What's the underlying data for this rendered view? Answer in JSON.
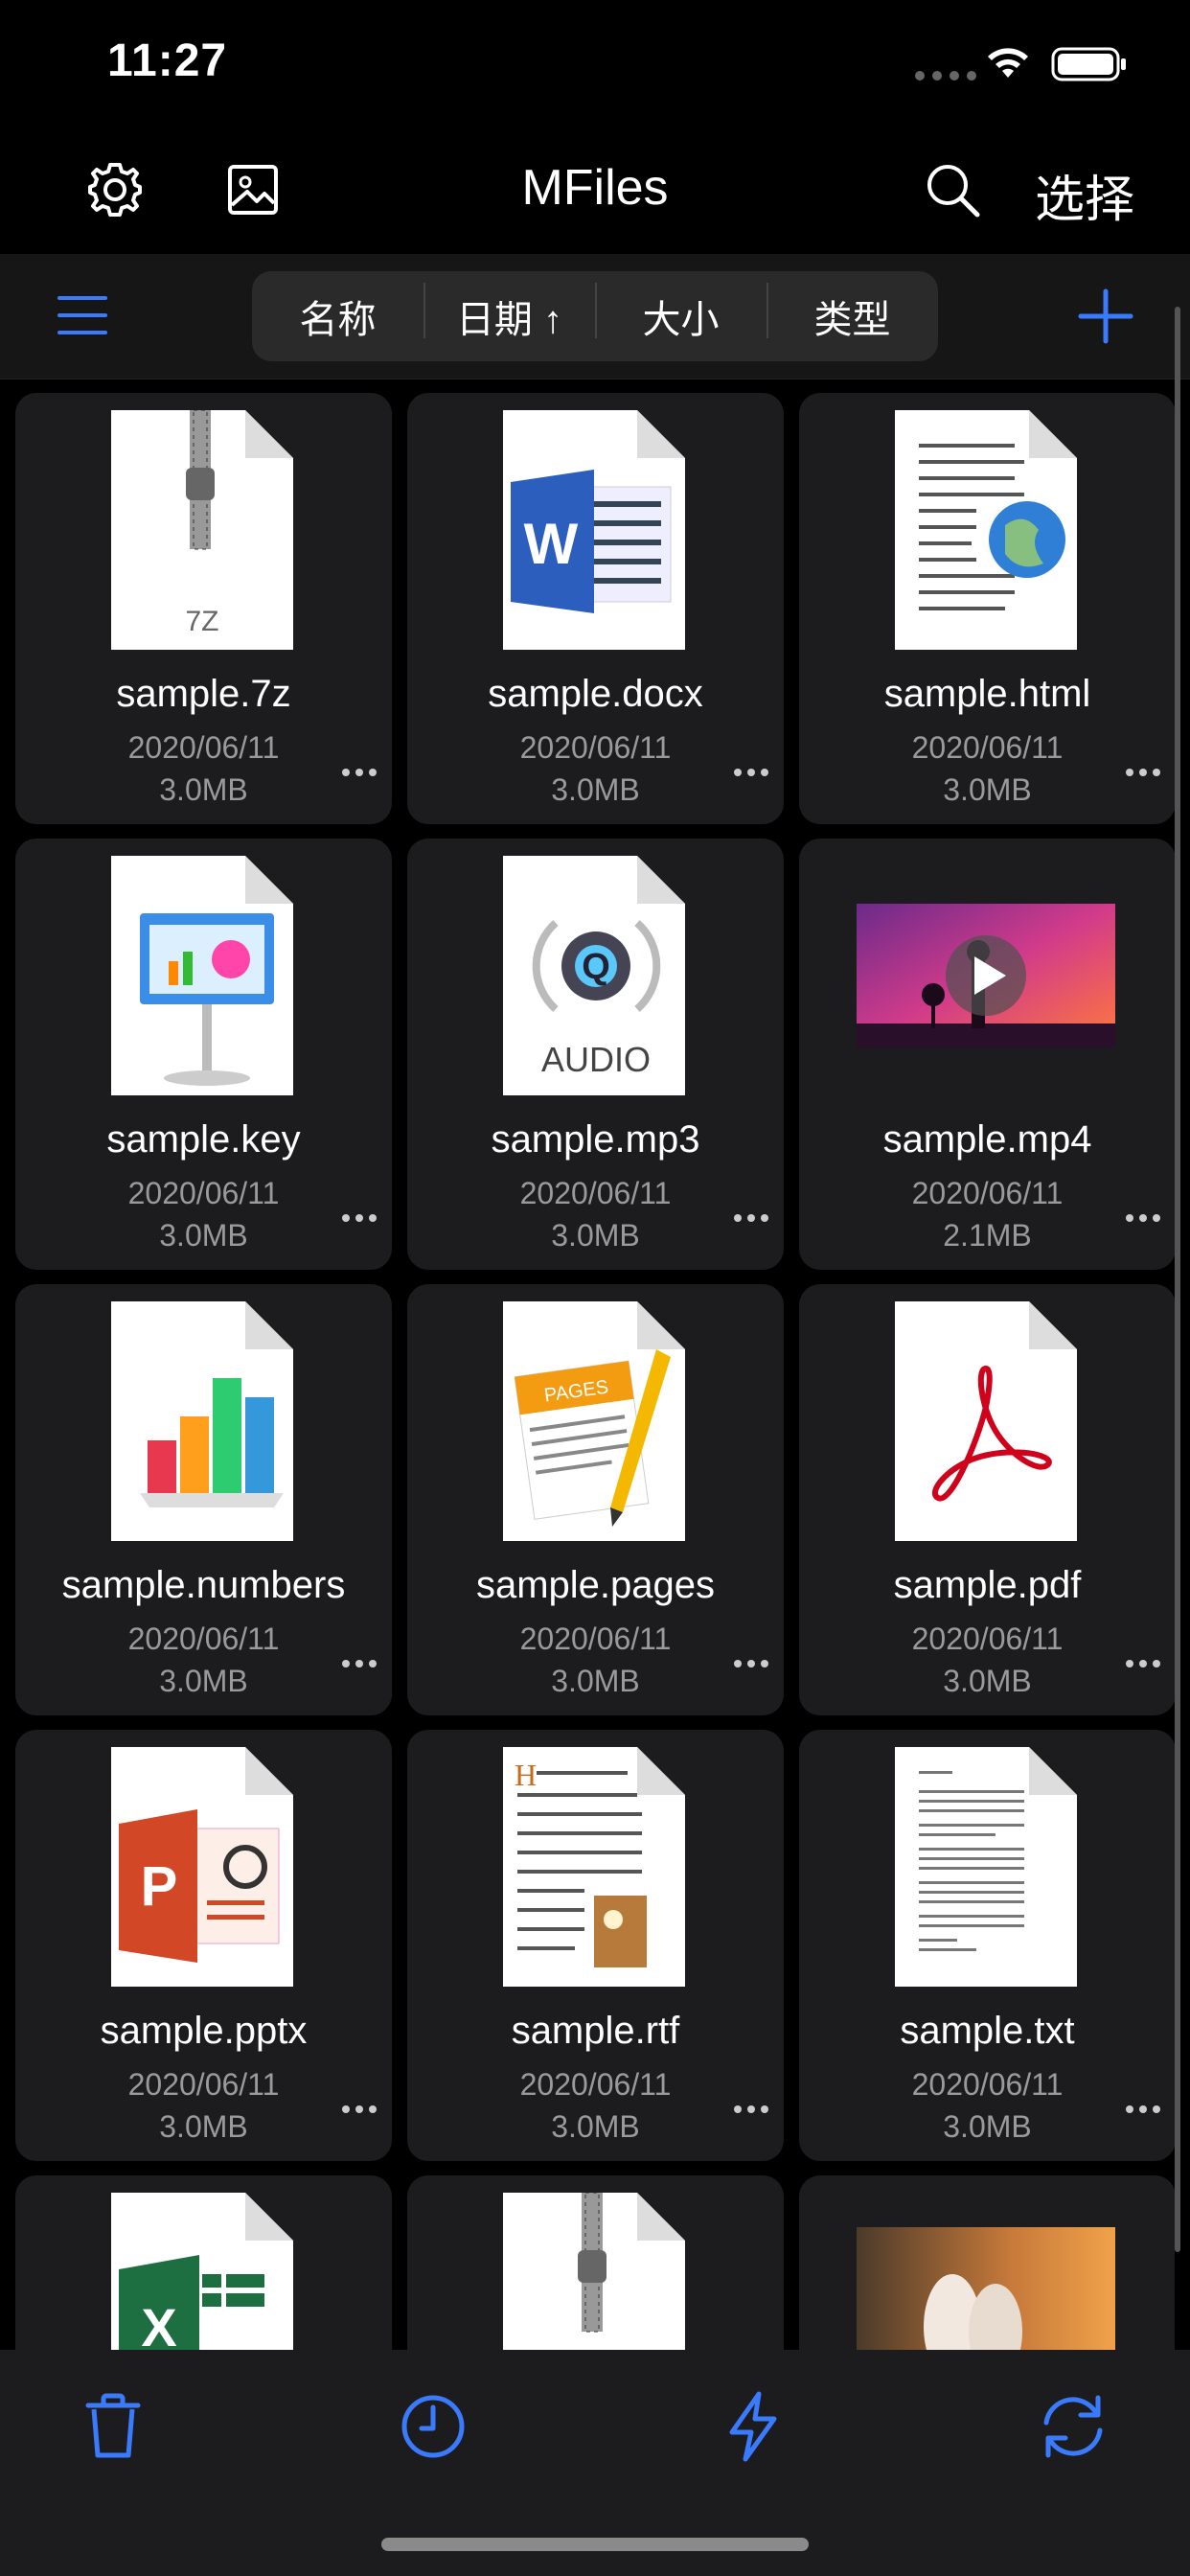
{
  "status_bar": {
    "time": "11:27"
  },
  "nav": {
    "title": "MFiles",
    "select_label": "选择"
  },
  "toolbar": {
    "sort_options": [
      {
        "label": "名称"
      },
      {
        "label": "日期 ↑"
      },
      {
        "label": "大小"
      },
      {
        "label": "类型"
      }
    ]
  },
  "files": [
    {
      "name": "sample.7z",
      "date": "2020/06/11",
      "size": "3.0MB",
      "icon": "zip-icon",
      "badge": "7Z"
    },
    {
      "name": "sample.docx",
      "date": "2020/06/11",
      "size": "3.0MB",
      "icon": "word-icon"
    },
    {
      "name": "sample.html",
      "date": "2020/06/11",
      "size": "3.0MB",
      "icon": "html-icon"
    },
    {
      "name": "sample.key",
      "date": "2020/06/11",
      "size": "3.0MB",
      "icon": "keynote-icon"
    },
    {
      "name": "sample.mp3",
      "date": "2020/06/11",
      "size": "3.0MB",
      "icon": "audio-icon",
      "badge": "AUDIO"
    },
    {
      "name": "sample.mp4",
      "date": "2020/06/11",
      "size": "2.1MB",
      "icon": "video-thumbnail"
    },
    {
      "name": "sample.numbers",
      "date": "2020/06/11",
      "size": "3.0MB",
      "icon": "numbers-icon"
    },
    {
      "name": "sample.pages",
      "date": "2020/06/11",
      "size": "3.0MB",
      "icon": "pages-icon",
      "badge": "PAGES"
    },
    {
      "name": "sample.pdf",
      "date": "2020/06/11",
      "size": "3.0MB",
      "icon": "pdf-icon"
    },
    {
      "name": "sample.pptx",
      "date": "2020/06/11",
      "size": "3.0MB",
      "icon": "powerpoint-icon"
    },
    {
      "name": "sample.rtf",
      "date": "2020/06/11",
      "size": "3.0MB",
      "icon": "rtf-icon"
    },
    {
      "name": "sample.txt",
      "date": "2020/06/11",
      "size": "3.0MB",
      "icon": "txt-icon"
    },
    {
      "name": "",
      "date": "",
      "size": "",
      "icon": "excel-icon"
    },
    {
      "name": "",
      "date": "",
      "size": "",
      "icon": "zip-icon"
    },
    {
      "name": "",
      "date": "",
      "size": "",
      "icon": "photo-thumbnail"
    }
  ],
  "colors": {
    "accent": "#3a7bfd",
    "card": "#1c1c1e",
    "secondary_text": "#9a9a9a"
  }
}
